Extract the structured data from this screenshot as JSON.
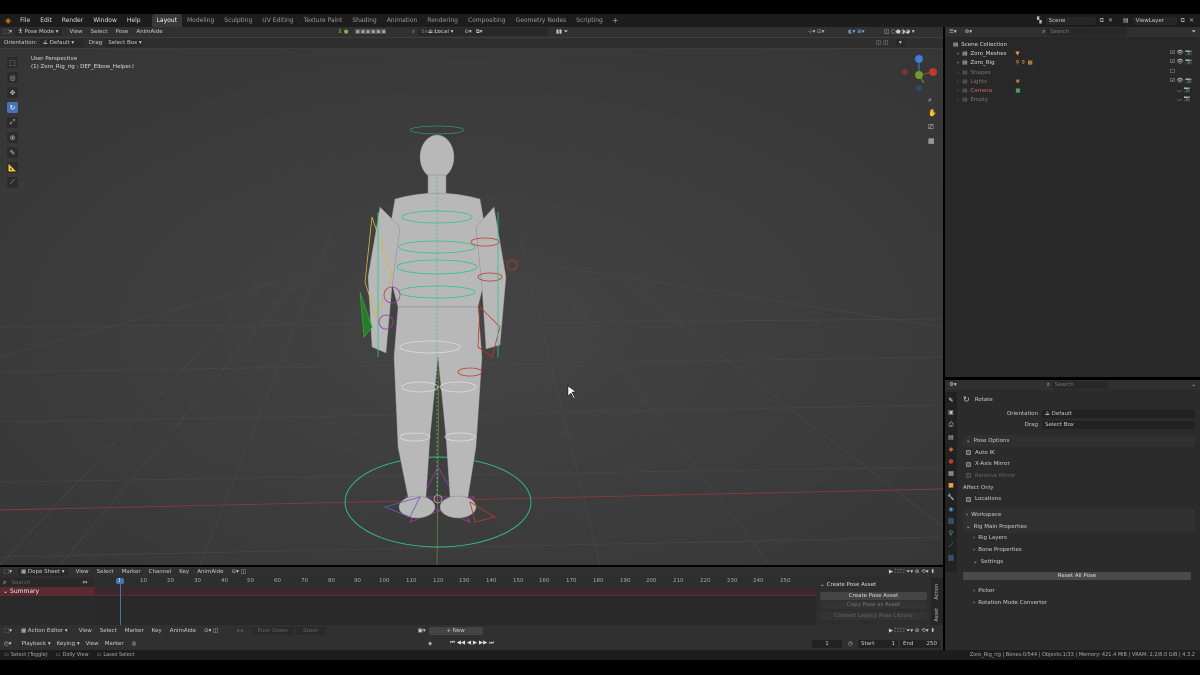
{
  "menu": {
    "items": [
      "File",
      "Edit",
      "Render",
      "Window",
      "Help"
    ],
    "workspaces": [
      "Layout",
      "Modeling",
      "Sculpting",
      "UV Editing",
      "Texture Paint",
      "Shading",
      "Animation",
      "Rendering",
      "Compositing",
      "Geometry Nodes",
      "Scripting"
    ],
    "active_workspace": "Layout",
    "scene_label": "Scene",
    "view_layer_label": "ViewLayer"
  },
  "viewport_header": {
    "mode": "Pose Mode",
    "menus": [
      "View",
      "Select",
      "Pose",
      "AnimAide"
    ],
    "transform_orientation": "Local",
    "search_placeholder": "Search",
    "pose_options_label": "Pose Options"
  },
  "tool_header": {
    "orientation_label": "Orientation:",
    "orientation_value": "Default",
    "drag_label": "Drag",
    "drag_value": "Select Box"
  },
  "viewport_info": {
    "perspective": "User Perspective",
    "object": "(1) Zoro_Rig_rig : DEF_Elbow_Helper.l"
  },
  "gizmo": {
    "x": "X",
    "y": "Y",
    "z": "Z"
  },
  "outliner": {
    "search_placeholder": "Search",
    "root": "Scene Collection",
    "items": [
      {
        "name": "Zoro_Meshes",
        "dim": false
      },
      {
        "name": "Zoro_Rig",
        "dim": false
      },
      {
        "name": "Shapes",
        "dim": true
      },
      {
        "name": "Lights",
        "dim": true
      },
      {
        "name": "Camera",
        "dim": true
      },
      {
        "name": "Empty",
        "dim": true
      }
    ]
  },
  "properties": {
    "search_placeholder": "Search",
    "tool_name": "Rotate",
    "orientation_label": "Orientation",
    "orientation_value": "Default",
    "drag_label": "Drag",
    "drag_value": "Select Box",
    "pose_options": "Pose Options",
    "auto_ik": "Auto IK",
    "x_axis_mirror": "X-Axis Mirror",
    "relative_mirror": "Relative Mirror",
    "affect_only": "Affect Only",
    "locations": "Locations",
    "workspace": "Workspace",
    "rig_main_properties": "Rig Main Properties",
    "rig_layers": "Rig Layers",
    "bone_properties": "Bone Properties",
    "settings": "Settings",
    "reset_all_pose": "Reset All Pose",
    "picker": "Picker",
    "rotation_mode_convertor": "Rotation Mode Convertor"
  },
  "dopesheet": {
    "editor": "Dope Sheet",
    "menus": [
      "View",
      "Select",
      "Marker",
      "Channel",
      "Key",
      "AnimAide"
    ],
    "search_placeholder": "Search",
    "summary": "Summary",
    "current_frame": "1",
    "ruler": [
      "10",
      "20",
      "30",
      "40",
      "50",
      "60",
      "70",
      "80",
      "90",
      "100",
      "110",
      "120",
      "130",
      "140",
      "150",
      "160",
      "170",
      "180",
      "190",
      "200",
      "210",
      "220",
      "230",
      "240",
      "250"
    ],
    "side_panel_title": "Create Pose Asset",
    "create_pose_asset": "Create Pose Asset",
    "copy_pose_as_asset": "Copy Pose as Asset",
    "convert_legacy": "Convert Legacy Pose Library",
    "side_tabs": [
      "Action",
      "Asset"
    ]
  },
  "action_editor": {
    "editor": "Action Editor",
    "menus": [
      "View",
      "Select",
      "Marker",
      "Key",
      "AnimAide"
    ],
    "push_down": "Push Down",
    "stash": "Stash",
    "new": "New"
  },
  "timeline": {
    "menus": [
      "Playback",
      "Keying",
      "View",
      "Marker"
    ],
    "frame": "1",
    "start_label": "Start",
    "start_value": "1",
    "end_label": "End",
    "end_value": "250"
  },
  "statusbar": {
    "left": [
      "Select (Toggle)",
      "Dolly View",
      "Lasso Select"
    ],
    "right": "Zoro_Rig_rig | Bones:0/544 | Objects:1/33 | Memory: 421.4 MiB | VRAM: 2.2/8.0 GiB | 4.3.2"
  },
  "colors": {
    "accent": "#4772b3",
    "viewport_bg": "#3d3d3d",
    "panel_bg": "#2b2b2b",
    "header_bg": "#303030",
    "x_axis": "#c0392b",
    "y_axis": "#6b9e2b",
    "z_axis": "#3d7ed6",
    "rig_green": "#2fc28f"
  }
}
